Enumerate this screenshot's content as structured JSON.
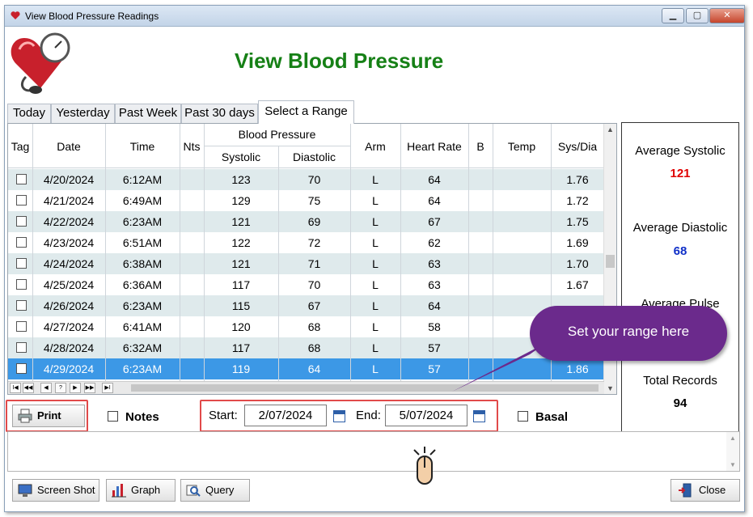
{
  "window": {
    "title": "View Blood Pressure Readings",
    "min_label": "▁",
    "max_label": "▢",
    "close_label": "✕"
  },
  "heading": "View Blood Pressure",
  "tabs": [
    {
      "label": "Today"
    },
    {
      "label": "Yesterday"
    },
    {
      "label": "Past Week"
    },
    {
      "label": "Past 30 days"
    },
    {
      "label": "Select a Range",
      "active": true
    }
  ],
  "table": {
    "headers": {
      "tag": "Tag",
      "date": "Date",
      "time": "Time",
      "nts": "Nts",
      "bp_group": "Blood Pressure",
      "systolic": "Systolic",
      "diastolic": "Diastolic",
      "arm": "Arm",
      "heart_rate": "Heart Rate",
      "b": "B",
      "temp": "Temp",
      "sys_dia": "Sys/Dia"
    },
    "rows": [
      {
        "date": "4/20/2024",
        "time": "6:12AM",
        "systolic": "123",
        "diastolic": "70",
        "arm": "L",
        "heart_rate": "64",
        "sys_dia": "1.76"
      },
      {
        "date": "4/21/2024",
        "time": "6:49AM",
        "systolic": "129",
        "diastolic": "75",
        "arm": "L",
        "heart_rate": "64",
        "sys_dia": "1.72"
      },
      {
        "date": "4/22/2024",
        "time": "6:23AM",
        "systolic": "121",
        "diastolic": "69",
        "arm": "L",
        "heart_rate": "67",
        "sys_dia": "1.75"
      },
      {
        "date": "4/23/2024",
        "time": "6:51AM",
        "systolic": "122",
        "diastolic": "72",
        "arm": "L",
        "heart_rate": "62",
        "sys_dia": "1.69"
      },
      {
        "date": "4/24/2024",
        "time": "6:38AM",
        "systolic": "121",
        "diastolic": "71",
        "arm": "L",
        "heart_rate": "63",
        "sys_dia": "1.70"
      },
      {
        "date": "4/25/2024",
        "time": "6:36AM",
        "systolic": "117",
        "diastolic": "70",
        "arm": "L",
        "heart_rate": "63",
        "sys_dia": "1.67"
      },
      {
        "date": "4/26/2024",
        "time": "6:23AM",
        "systolic": "115",
        "diastolic": "67",
        "arm": "L",
        "heart_rate": "64",
        "sys_dia": ""
      },
      {
        "date": "4/27/2024",
        "time": "6:41AM",
        "systolic": "120",
        "diastolic": "68",
        "arm": "L",
        "heart_rate": "58",
        "sys_dia": ""
      },
      {
        "date": "4/28/2024",
        "time": "6:32AM",
        "systolic": "117",
        "diastolic": "68",
        "arm": "L",
        "heart_rate": "57",
        "sys_dia": ""
      },
      {
        "date": "4/29/2024",
        "time": "6:23AM",
        "systolic": "119",
        "diastolic": "64",
        "arm": "L",
        "heart_rate": "57",
        "sys_dia": "1.86",
        "selected": true
      }
    ],
    "nav_buttons": [
      "I◀",
      "◀◀",
      "◀",
      "?",
      "▶",
      "▶▶",
      "▶I"
    ]
  },
  "stats": {
    "avg_systolic_label": "Average Systolic",
    "avg_systolic_value": "121",
    "avg_diastolic_label": "Average Diastolic",
    "avg_diastolic_value": "68",
    "avg_pulse_label": "Average Pulse",
    "total_records_label": "Total Records",
    "total_records_value": "94",
    "colors": {
      "systolic": "#e00000",
      "diastolic": "#1030c8",
      "total": "#000000"
    }
  },
  "controls": {
    "print_label": "Print",
    "notes_label": "Notes",
    "start_label": "Start:",
    "start_value": "2/07/2024",
    "end_label": "End:",
    "end_value": "5/07/2024",
    "basal_label": "Basal"
  },
  "bottom": {
    "screenshot_label": "Screen Shot",
    "graph_label": "Graph",
    "query_label": "Query",
    "close_label": "Close"
  },
  "callout": {
    "text": "Set your range here",
    "color": "#6b2a8c"
  },
  "colors": {
    "heading": "#168016",
    "row_alt": "#dfeaec",
    "selected": "#3c98e6",
    "highlight_box": "#e14a4a"
  },
  "icons": [
    "heart-monitor-logo-icon",
    "printer-icon",
    "calendar-icon",
    "screenshot-icon",
    "bar-chart-icon",
    "query-icon",
    "close-door-icon",
    "pointing-hand-icon",
    "mouse-click-icon"
  ]
}
